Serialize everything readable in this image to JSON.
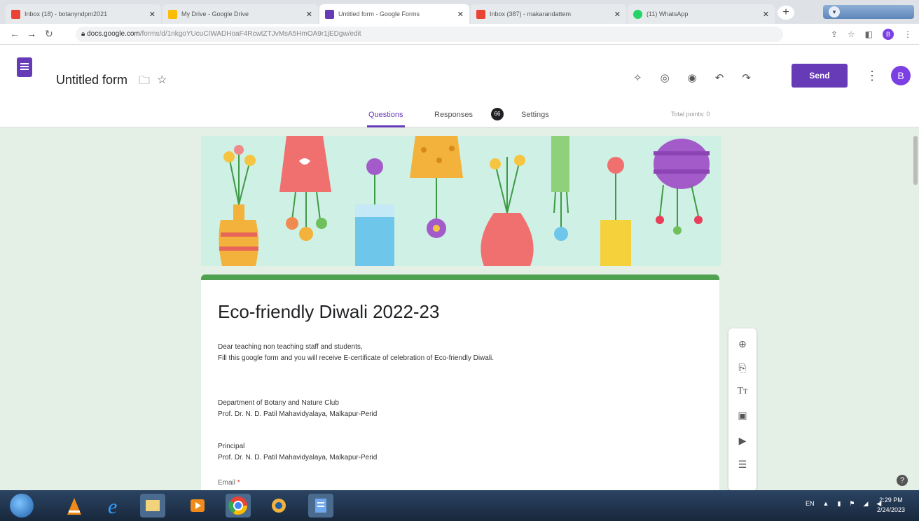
{
  "browser": {
    "tabs": [
      {
        "title": "Inbox (18) - botanyndpm2021"
      },
      {
        "title": "My Drive - Google Drive"
      },
      {
        "title": "Untitled form - Google Forms"
      },
      {
        "title": "Inbox (387) - makarandattem"
      },
      {
        "title": "(11) WhatsApp"
      }
    ],
    "url_host": "docs.google.com",
    "url_path": "/forms/d/1nkgoYUcuCIWADHoaF4RcwtZTJvMsA5HmOA9r1jEDgw/edit",
    "profile_initial": "B"
  },
  "form_header": {
    "title": "Untitled form",
    "send_label": "Send",
    "avatar_initial": "B",
    "tabs": {
      "questions": "Questions",
      "responses": "Responses",
      "responses_count": "66",
      "settings": "Settings"
    },
    "total_points": "Total points: 0"
  },
  "form": {
    "title": "Eco-friendly Diwali 2022-23",
    "desc_line1": "Dear teaching non teaching staff and students,",
    "desc_line2": "Fill this google form and you will receive E-certificate of celebration of Eco-friendly Diwali.",
    "org_line1": "Department of Botany and Nature Club",
    "org_line2": "Prof. Dr. N. D. Patil Mahavidyalaya, Malkapur-Perid",
    "principal_line1": "Principal",
    "principal_line2": "Prof. Dr. N. D. Patil Mahavidyalaya, Malkapur-Perid",
    "email_label": "Email",
    "required_mark": "*"
  },
  "taskbar": {
    "lang": "EN",
    "time": "2:29 PM",
    "date": "2/24/2023"
  },
  "colors": {
    "accent": "#673ab7",
    "header_stripe": "#4ea24f",
    "background": "#e4efe6"
  }
}
